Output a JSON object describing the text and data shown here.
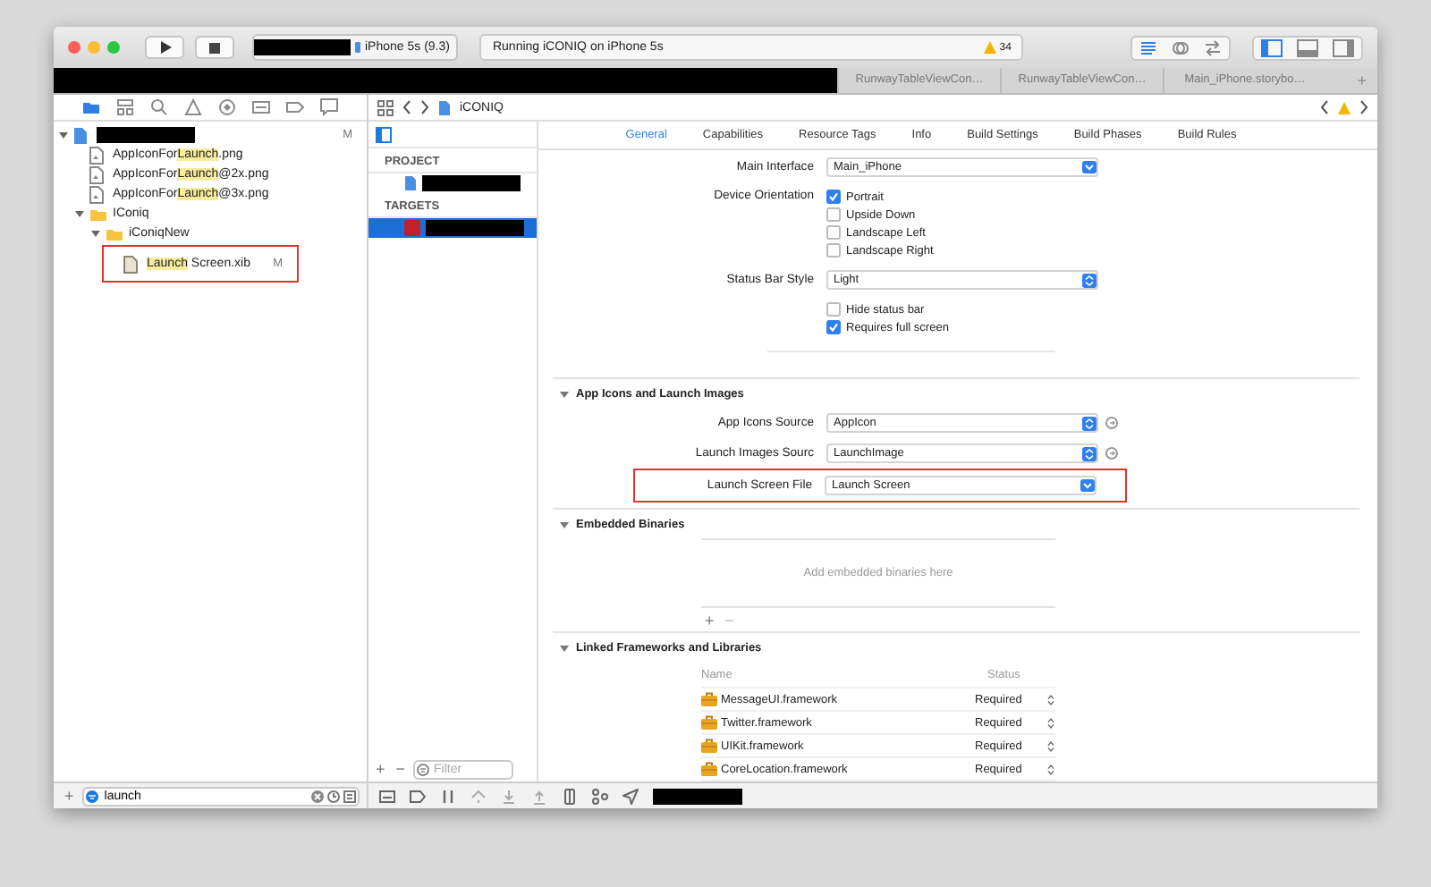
{
  "toolbar": {
    "device": "iPhone 5s (9.3)",
    "status": "Running iCONIQ on iPhone 5s",
    "warning_count": "34",
    "editor_modes": [
      {
        "kind": "standard",
        "selected": true
      },
      {
        "kind": "assistant",
        "selected": false
      },
      {
        "kind": "version",
        "selected": false
      }
    ],
    "panels": [
      {
        "kind": "navigator",
        "on": true
      },
      {
        "kind": "debug",
        "on": false
      },
      {
        "kind": "utilities",
        "on": false
      }
    ]
  },
  "editor_tabs": [
    {
      "label": "RunwayTableViewCon…"
    },
    {
      "label": "RunwayTableViewCon…"
    },
    {
      "label": "Main_iPhone.storybo…"
    }
  ],
  "add_tab": "+",
  "navigator": {
    "tools": [
      {
        "kind": "folder",
        "selected": true
      },
      {
        "kind": "hierarchy",
        "selected": false
      },
      {
        "kind": "search",
        "selected": false
      },
      {
        "kind": "warning",
        "selected": false
      },
      {
        "kind": "test",
        "selected": false
      },
      {
        "kind": "debug",
        "selected": false
      },
      {
        "kind": "breakpoint",
        "selected": false
      },
      {
        "kind": "report",
        "selected": false
      }
    ],
    "tree": [
      {
        "kind": "project",
        "redacted": true,
        "badge": "M",
        "expanded": true,
        "children": [
          {
            "kind": "image",
            "name": [
              {
                "text": "AppIconFor",
                "match": false
              },
              {
                "text": "Launch",
                "match": true
              },
              {
                "text": ".png",
                "match": false
              }
            ]
          },
          {
            "kind": "image",
            "name": [
              {
                "text": "AppIconFor",
                "match": false
              },
              {
                "text": "Launch",
                "match": true
              },
              {
                "text": "@2x.png",
                "match": false
              }
            ]
          },
          {
            "kind": "image",
            "name": [
              {
                "text": "AppIconFor",
                "match": false
              },
              {
                "text": "Launch",
                "match": true
              },
              {
                "text": "@3x.png",
                "match": false
              }
            ]
          },
          {
            "kind": "folder",
            "name": [
              {
                "text": "IConiq",
                "match": false
              }
            ],
            "expanded": true,
            "children": [
              {
                "kind": "folder",
                "name": [
                  {
                    "text": "iConiqNew",
                    "match": false
                  }
                ],
                "expanded": true,
                "children": [
                  {
                    "kind": "file",
                    "name": [
                      {
                        "text": "Launch",
                        "match": true
                      },
                      {
                        "text": " Screen.xib",
                        "match": false
                      }
                    ],
                    "badge": "M",
                    "annotated": true
                  }
                ]
              }
            ]
          }
        ]
      }
    ],
    "add": "+",
    "filter": "launch"
  },
  "jump_bar": {
    "item": "iCONIQ"
  },
  "targets_list": {
    "sections": [
      {
        "title": "PROJECT",
        "items": [
          {
            "kind": "project",
            "redacted": true,
            "selected": false
          }
        ]
      },
      {
        "title": "TARGETS",
        "items": [
          {
            "kind": "target",
            "redacted": true,
            "selected": true
          }
        ]
      }
    ],
    "add": "+",
    "remove": "−",
    "filter_placeholder": "Filter"
  },
  "settings_tabs": [
    {
      "label": "General",
      "selected": true
    },
    {
      "label": "Capabilities",
      "selected": false
    },
    {
      "label": "Resource Tags",
      "selected": false
    },
    {
      "label": "Info",
      "selected": false
    },
    {
      "label": "Build Settings",
      "selected": false
    },
    {
      "label": "Build Phases",
      "selected": false
    },
    {
      "label": "Build Rules",
      "selected": false
    }
  ],
  "sections": [
    {
      "kind": "plain",
      "rows": [
        {
          "kind": "combo",
          "label": "Main Interface",
          "value": "Main_iPhone"
        },
        {
          "kind": "checks",
          "label": "Device Orientation",
          "options": [
            {
              "label": "Portrait",
              "checked": true
            },
            {
              "label": "Upside Down",
              "checked": false
            },
            {
              "label": "Landscape Left",
              "checked": false
            },
            {
              "label": "Landscape Right",
              "checked": false
            }
          ]
        },
        {
          "kind": "popup",
          "label": "Status Bar Style",
          "value": "Light"
        },
        {
          "kind": "checks",
          "options": [
            {
              "label": "Hide status bar",
              "checked": false
            },
            {
              "label": "Requires full screen",
              "checked": true
            }
          ]
        }
      ]
    },
    {
      "kind": "titled",
      "title": "App Icons and Launch Images",
      "expanded": true,
      "rows": [
        {
          "kind": "popup",
          "label": "App Icons Source",
          "value": "AppIcon",
          "go": true
        },
        {
          "kind": "popup",
          "label": "Launch Images Sourc",
          "value": "LaunchImage",
          "go": true
        },
        {
          "kind": "combo",
          "label": "Launch Screen File",
          "value": "Launch Screen",
          "annotated": true
        }
      ]
    },
    {
      "kind": "binaries",
      "title": "Embedded Binaries",
      "expanded": true,
      "placeholder": "Add embedded binaries here",
      "add": "+",
      "remove": "−"
    },
    {
      "kind": "frameworks",
      "title": "Linked Frameworks and Libraries",
      "expanded": true,
      "columns": [
        "Name",
        "Status"
      ],
      "rows": [
        {
          "name": "MessageUI.framework",
          "status": "Required"
        },
        {
          "name": "Twitter.framework",
          "status": "Required"
        },
        {
          "name": "UIKit.framework",
          "status": "Required"
        },
        {
          "name": "CoreLocation.framework",
          "status": "Required"
        }
      ]
    }
  ]
}
